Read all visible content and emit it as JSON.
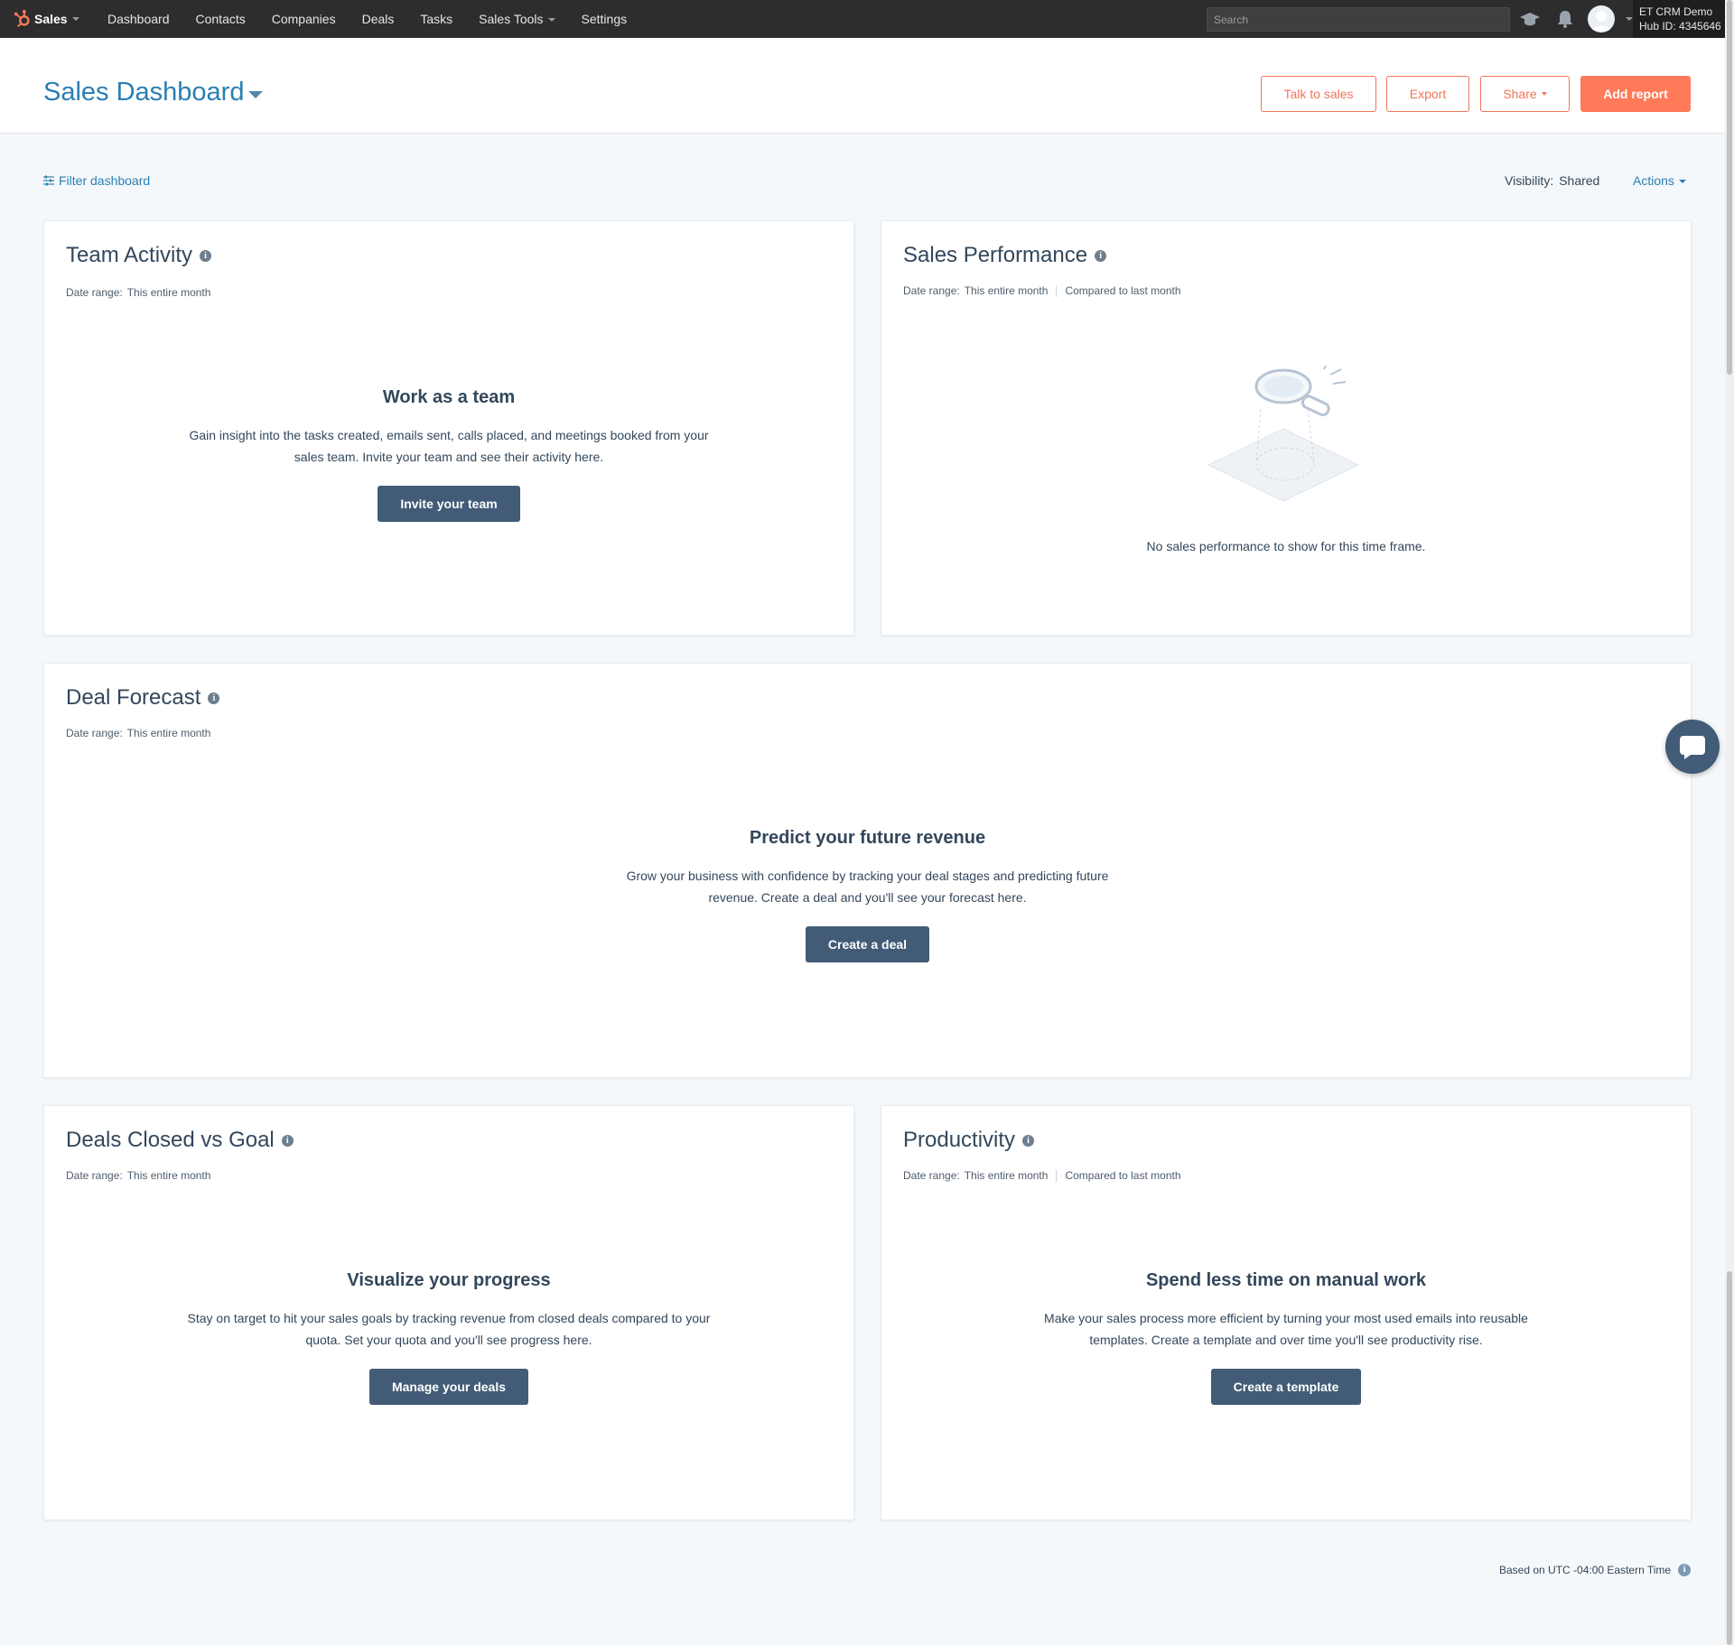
{
  "nav": {
    "brand": "Sales",
    "items": [
      "Dashboard",
      "Contacts",
      "Companies",
      "Deals",
      "Tasks",
      "Sales Tools",
      "Settings"
    ],
    "search_placeholder": "Search",
    "account_name": "ET CRM Demo",
    "hub_id": "Hub ID: 4345646",
    "icons": [
      "academy-icon",
      "bell-icon"
    ]
  },
  "header": {
    "title": "Sales Dashboard",
    "buttons": {
      "talk_to_sales": "Talk to sales",
      "export": "Export",
      "share": "Share",
      "add_report": "Add report"
    }
  },
  "filter_bar": {
    "filter_label": "Filter dashboard",
    "visibility_label": "Visibility:",
    "visibility_value": "Shared",
    "actions_label": "Actions"
  },
  "cards": {
    "team_activity": {
      "title": "Team Activity",
      "date_label": "Date range:",
      "date_value": "This entire month",
      "heading": "Work as a team",
      "description": "Gain insight into the tasks created, emails sent, calls placed, and meetings booked from your sales team. Invite your team and see their activity here.",
      "button": "Invite your team"
    },
    "sales_performance": {
      "title": "Sales Performance",
      "date_label": "Date range:",
      "date_value": "This entire month",
      "compare": "Compared to last month",
      "empty_message": "No sales performance to show for this time frame."
    },
    "deal_forecast": {
      "title": "Deal Forecast",
      "date_label": "Date range:",
      "date_value": "This entire month",
      "heading": "Predict your future revenue",
      "description": "Grow your business with confidence by tracking your deal stages and predicting future revenue. Create a deal and you'll see your forecast here.",
      "button": "Create a deal"
    },
    "deals_closed": {
      "title": "Deals Closed vs Goal",
      "date_label": "Date range:",
      "date_value": "This entire month",
      "heading": "Visualize your progress",
      "description": "Stay on target to hit your sales goals by tracking revenue from closed deals compared to your quota. Set your quota and you'll see progress here.",
      "button": "Manage your deals"
    },
    "productivity": {
      "title": "Productivity",
      "date_label": "Date range:",
      "date_value": "This entire month",
      "compare": "Compared to last month",
      "heading": "Spend less time on manual work",
      "description": "Make your sales process more efficient by turning your most used emails into reusable templates. Create a template and over time you'll see productivity rise.",
      "button": "Create a template"
    }
  },
  "footer": {
    "timezone": "Based on UTC -04:00 Eastern Time"
  },
  "colors": {
    "nav_bg": "#2d2d2d",
    "link": "#2a7fb2",
    "accent": "#ff7a59",
    "dark_button": "#425b76",
    "page_bg": "#f5f8fa"
  }
}
